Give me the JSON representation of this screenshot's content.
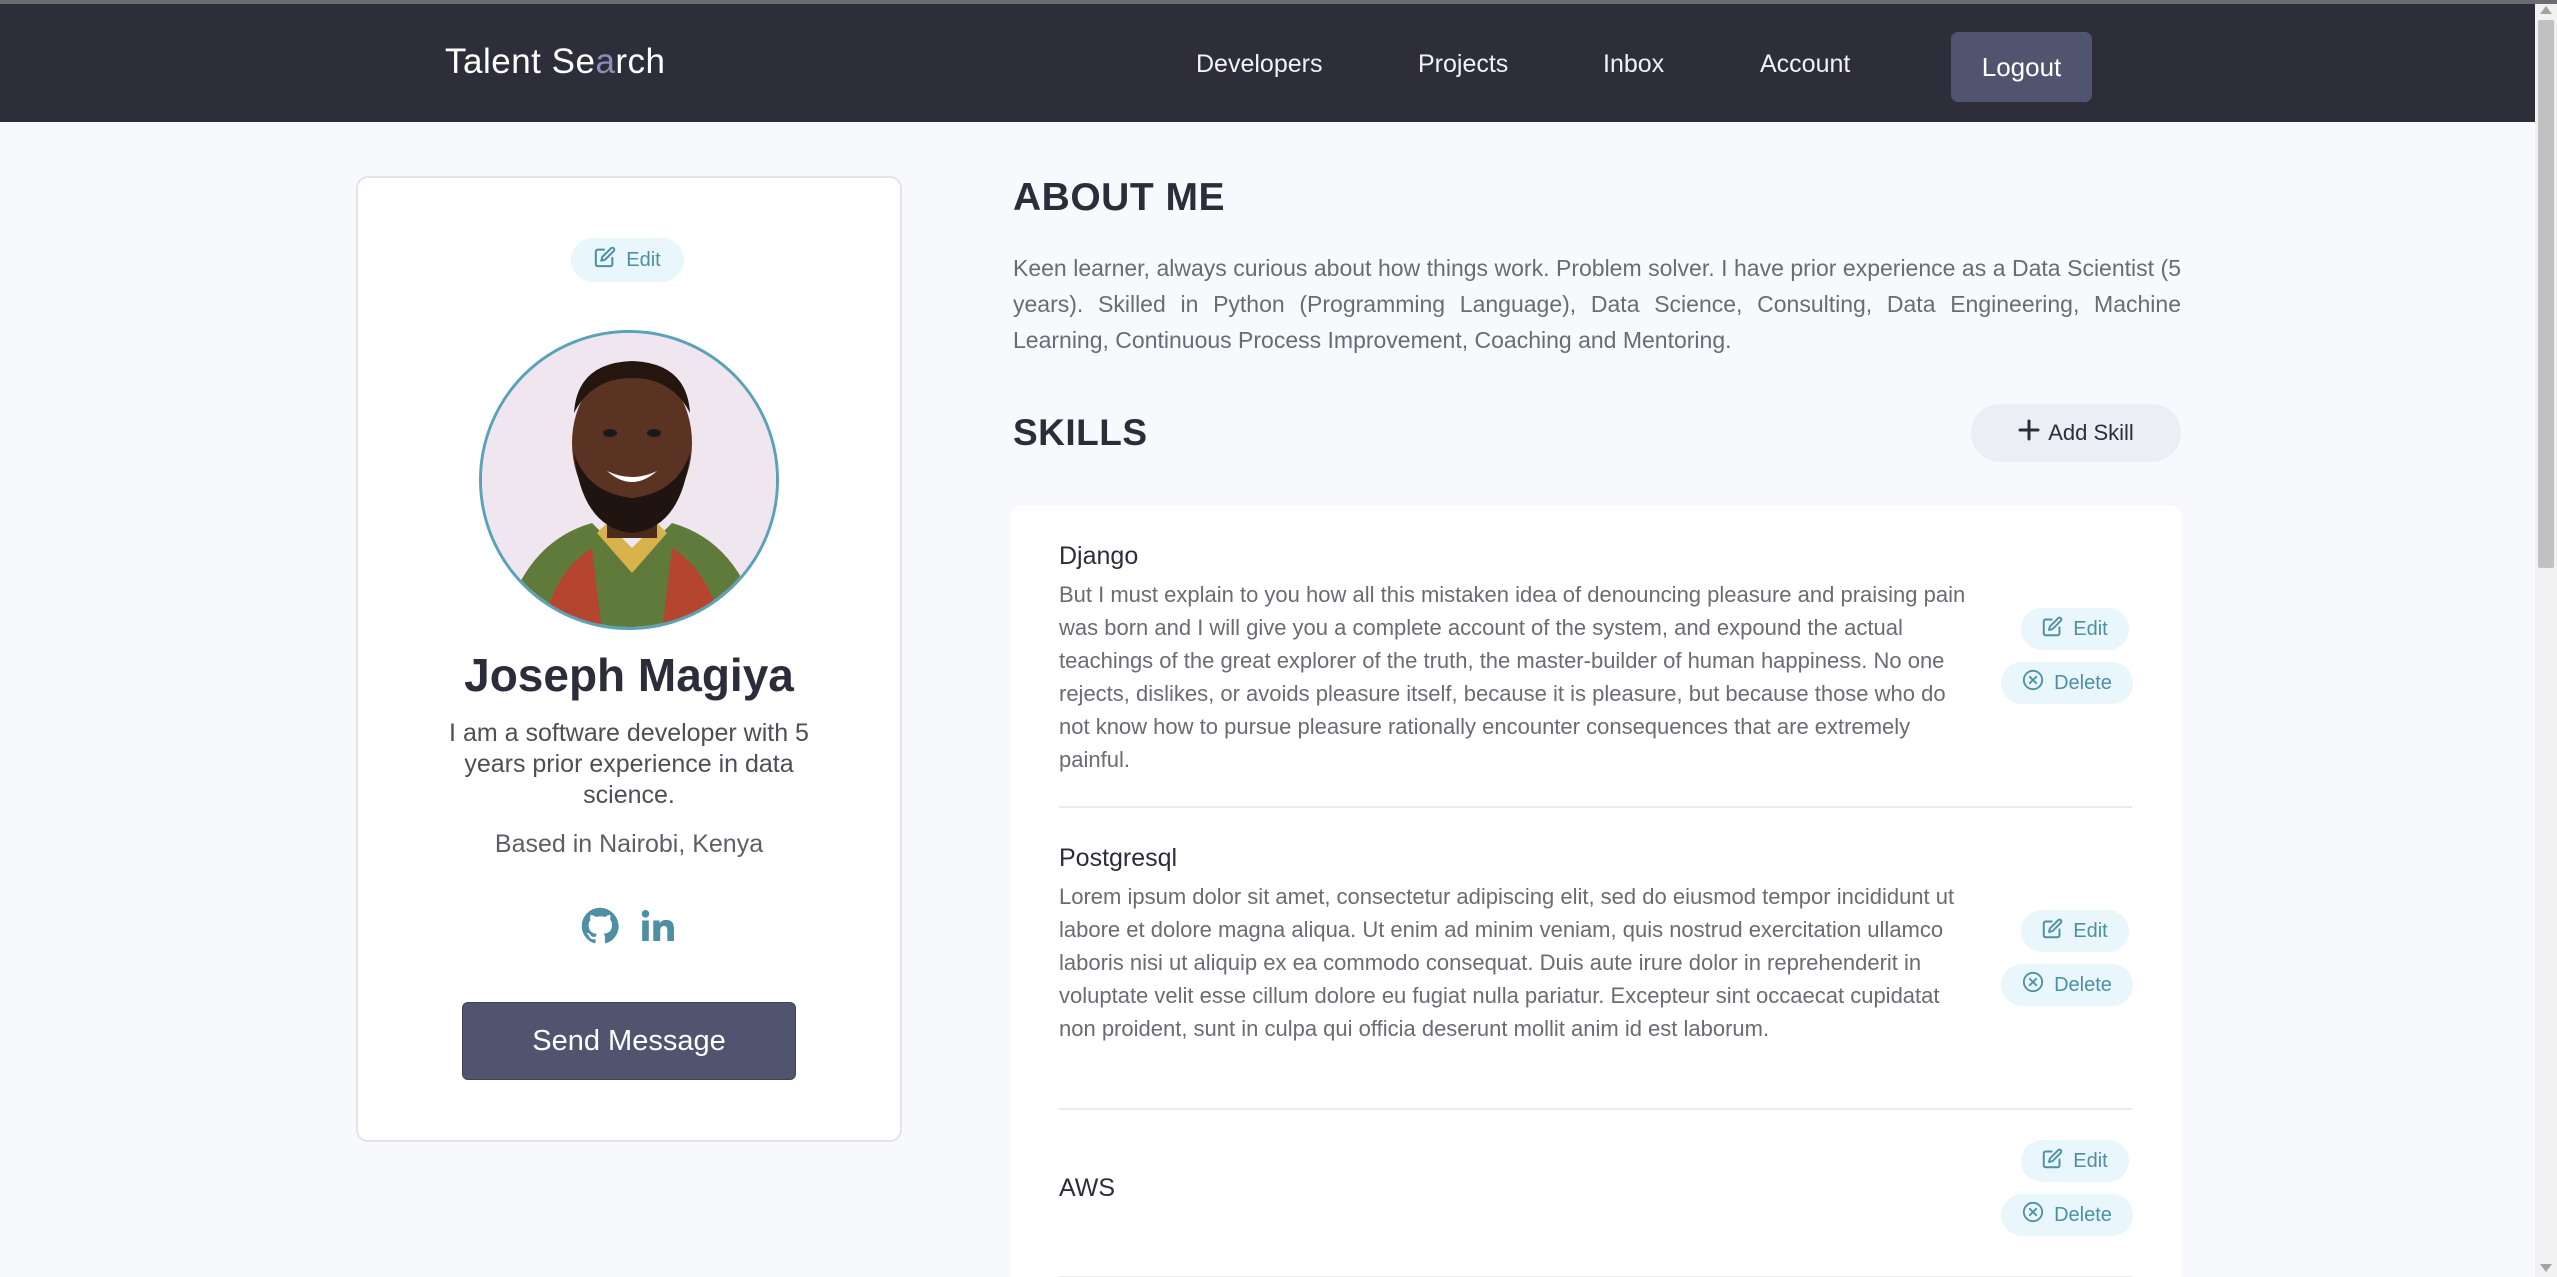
{
  "nav": {
    "logo_part1": "Talent Se",
    "logo_lens": "a",
    "logo_part2": "rch",
    "links": [
      "Developers",
      "Projects",
      "Inbox",
      "Account"
    ],
    "logout": "Logout"
  },
  "profile": {
    "edit_label": "Edit",
    "name": "Joseph Magiya",
    "bio": "I am a software developer with 5 years prior experience in data science.",
    "location": "Based in Nairobi, Kenya",
    "socials": [
      "github-icon",
      "linkedin-icon"
    ],
    "send_message": "Send Message"
  },
  "about": {
    "title": "ABOUT ME",
    "text": "Keen learner, always curious about how things work. Problem solver. I have prior experience as a Data Scientist (5 years). Skilled in Python (Programming Language), Data Science, Consulting, Data Engineering, Machine Learning, Continuous Process Improvement, Coaching and Mentoring."
  },
  "skills": {
    "title": "SKILLS",
    "add_label": "Add Skill",
    "edit_label": "Edit",
    "delete_label": "Delete",
    "items": [
      {
        "name": "Django",
        "description": "But I must explain to you how all this mistaken idea of denouncing pleasure and praising pain was born and I will give you a complete account of the system, and expound the actual teachings of the great explorer of the truth, the master-builder of human happiness. No one rejects, dislikes, or avoids pleasure itself, because it is pleasure, but because those who do not know how to pursue pleasure rationally encounter consequences that are extremely painful."
      },
      {
        "name": "Postgresql",
        "description": "Lorem ipsum dolor sit amet, consectetur adipiscing elit, sed do eiusmod tempor incididunt ut labore et dolore magna aliqua. Ut enim ad minim veniam, quis nostrud exercitation ullamco laboris nisi ut aliquip ex ea commodo consequat. Duis aute irure dolor in reprehenderit in voluptate velit esse cillum dolore eu fugiat nulla pariatur. Excepteur sint occaecat cupidatat non proident, sunt in culpa qui officia deserunt mollit anim id est laborum."
      },
      {
        "name": "AWS",
        "description": ""
      }
    ]
  },
  "colors": {
    "nav_bg": "#2d2e3a",
    "accent": "#51546f",
    "teal": "#4d8fa3",
    "pill_bg": "#e9f6fb"
  }
}
